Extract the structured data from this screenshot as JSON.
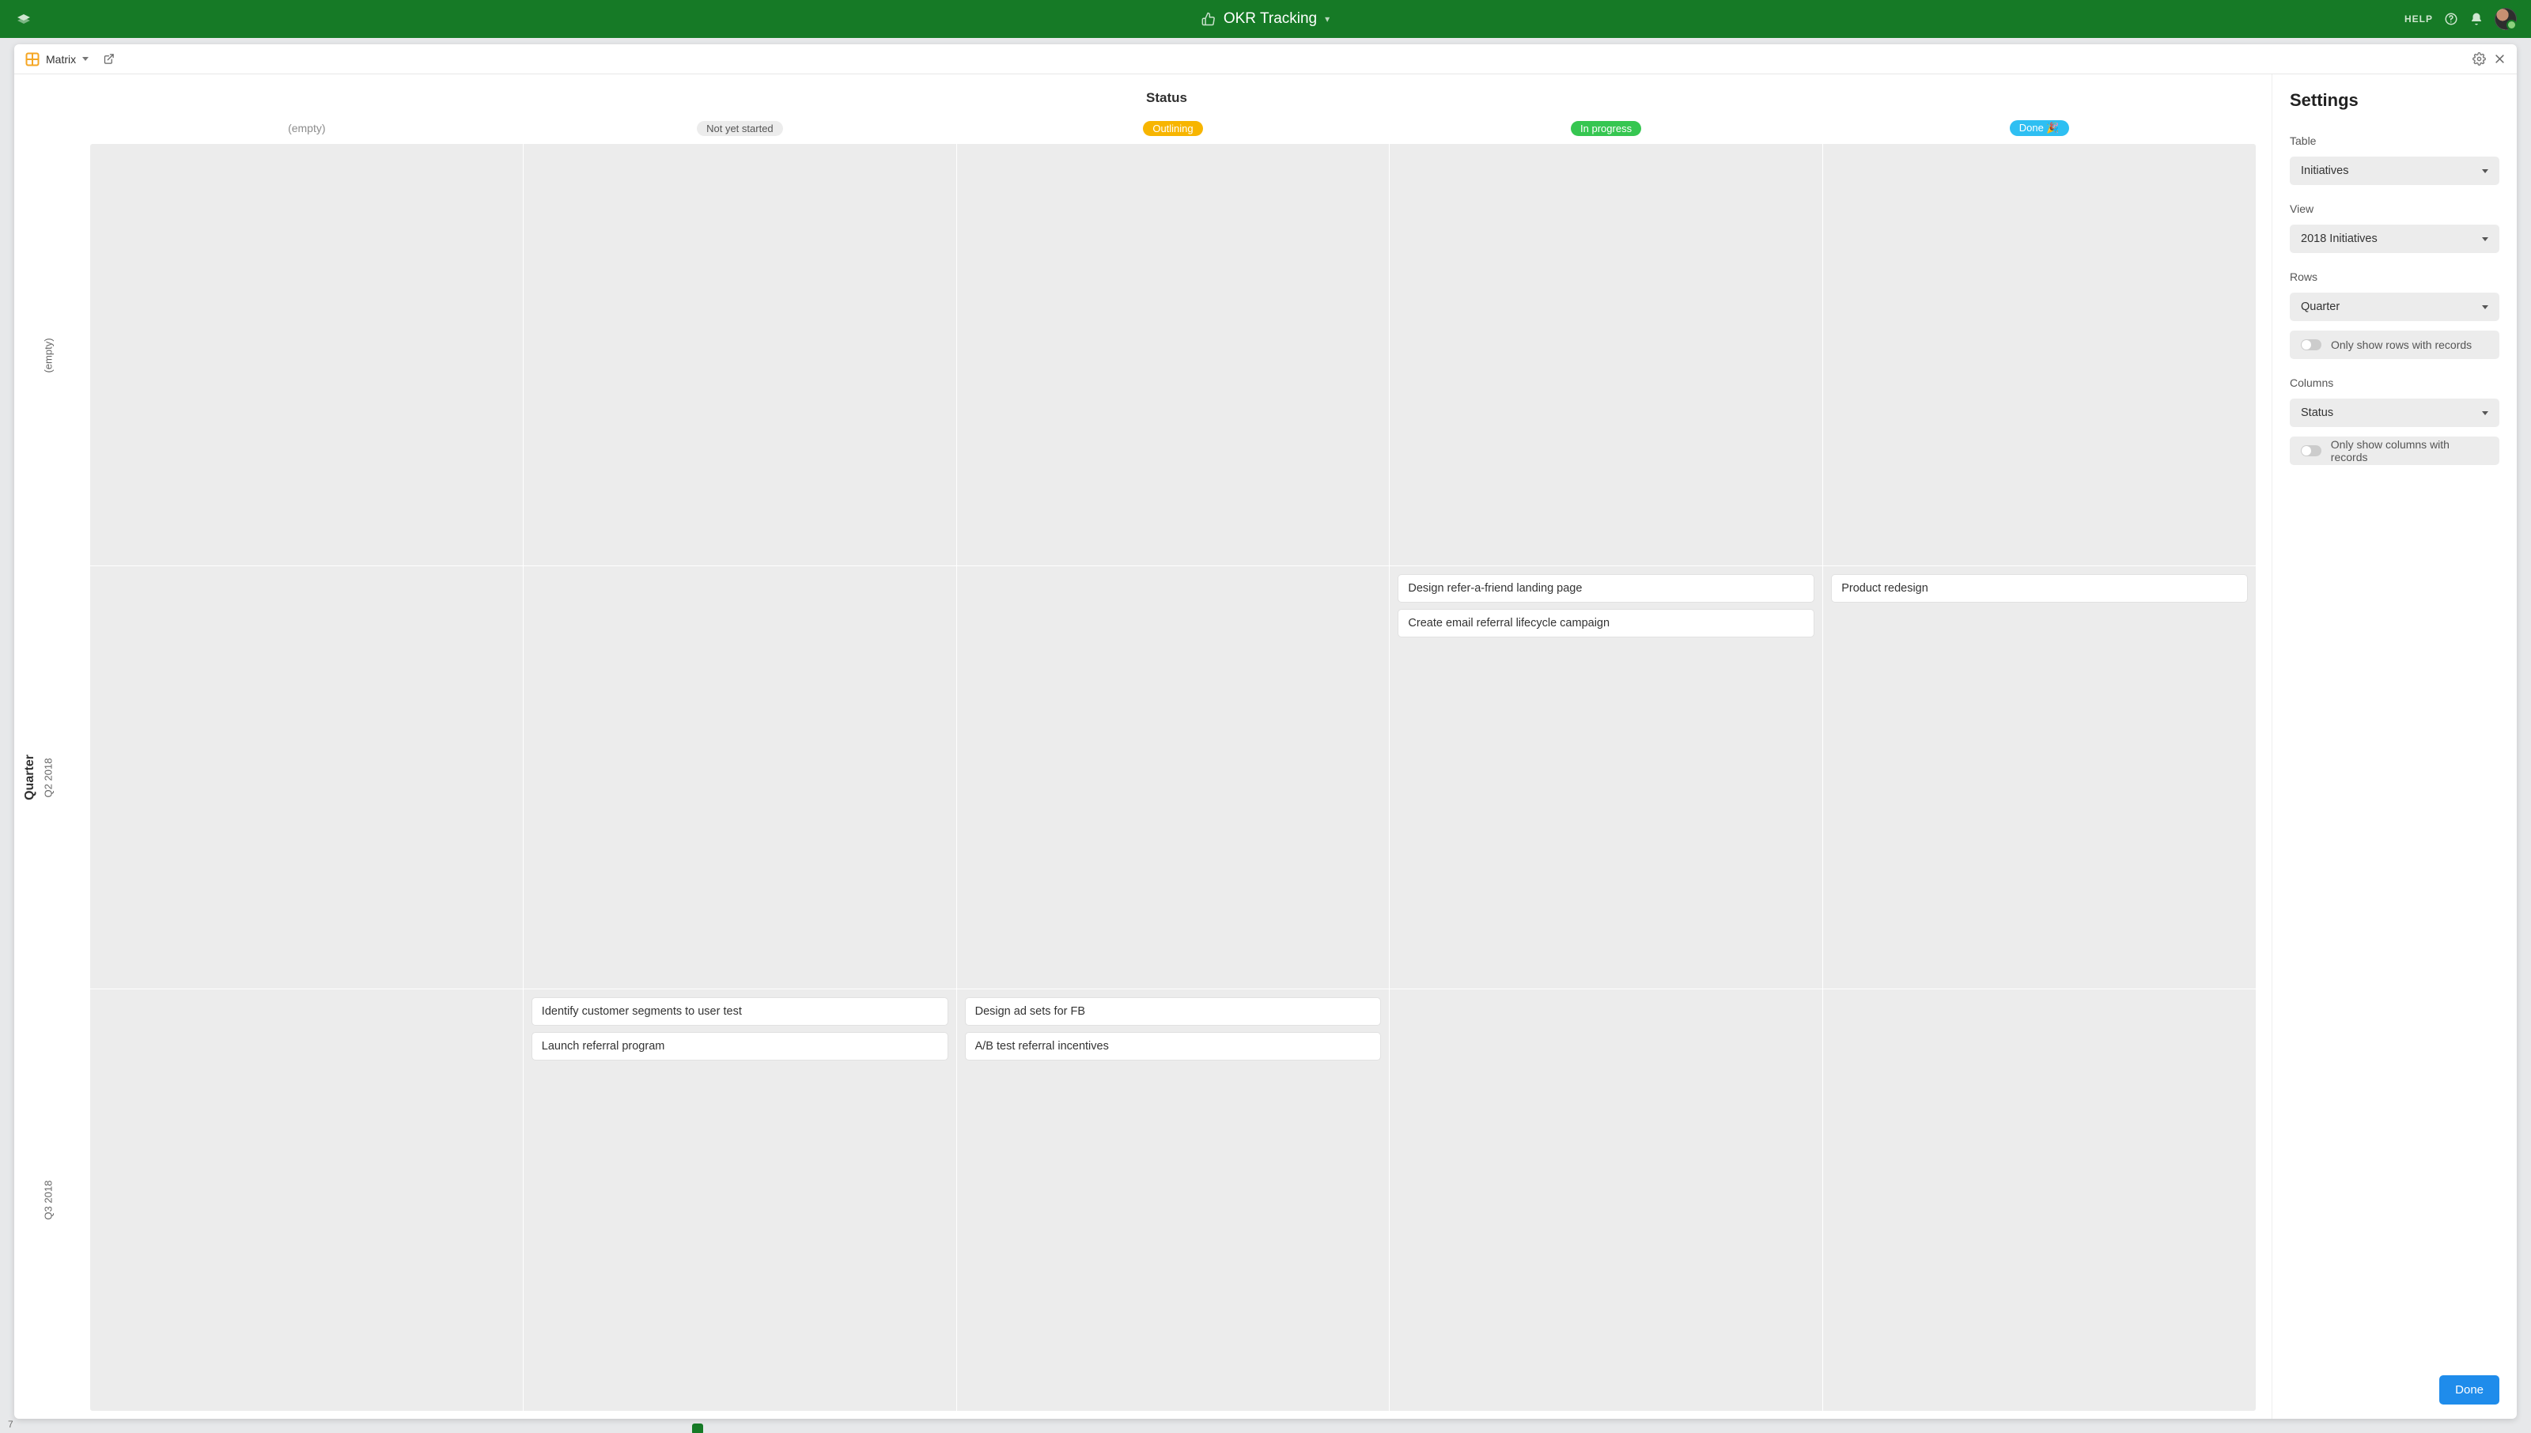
{
  "topbar": {
    "title": "OKR Tracking",
    "help_label": "HELP"
  },
  "modal": {
    "view_type": "Matrix",
    "corner_value": "7"
  },
  "matrix": {
    "column_axis_label": "Status",
    "row_axis_label": "Quarter",
    "columns": [
      {
        "label": "(empty)",
        "style": "empty"
      },
      {
        "label": "Not yet started",
        "style": "grey"
      },
      {
        "label": "Outlining",
        "style": "orange"
      },
      {
        "label": "In progress",
        "style": "green"
      },
      {
        "label": "Done 🎉",
        "style": "blue"
      }
    ],
    "rows": [
      {
        "label": "(empty)",
        "cells": [
          [],
          [],
          [],
          [],
          []
        ]
      },
      {
        "label": "Q2 2018",
        "cells": [
          [],
          [],
          [],
          [
            "Design refer-a-friend landing page",
            "Create email referral lifecycle campaign"
          ],
          [
            "Product redesign"
          ]
        ]
      },
      {
        "label": "Q3 2018",
        "cells": [
          [],
          [
            "Identify customer segments to user test",
            "Launch referral program"
          ],
          [
            "Design ad sets for FB",
            "A/B test referral incentives"
          ],
          [],
          []
        ]
      }
    ]
  },
  "settings": {
    "title": "Settings",
    "table_label": "Table",
    "table_value": "Initiatives",
    "view_label": "View",
    "view_value": "2018 Initiatives",
    "rows_label": "Rows",
    "rows_value": "Quarter",
    "rows_toggle_label": "Only show rows with records",
    "columns_label": "Columns",
    "columns_value": "Status",
    "columns_toggle_label": "Only show columns with records",
    "done_label": "Done"
  }
}
